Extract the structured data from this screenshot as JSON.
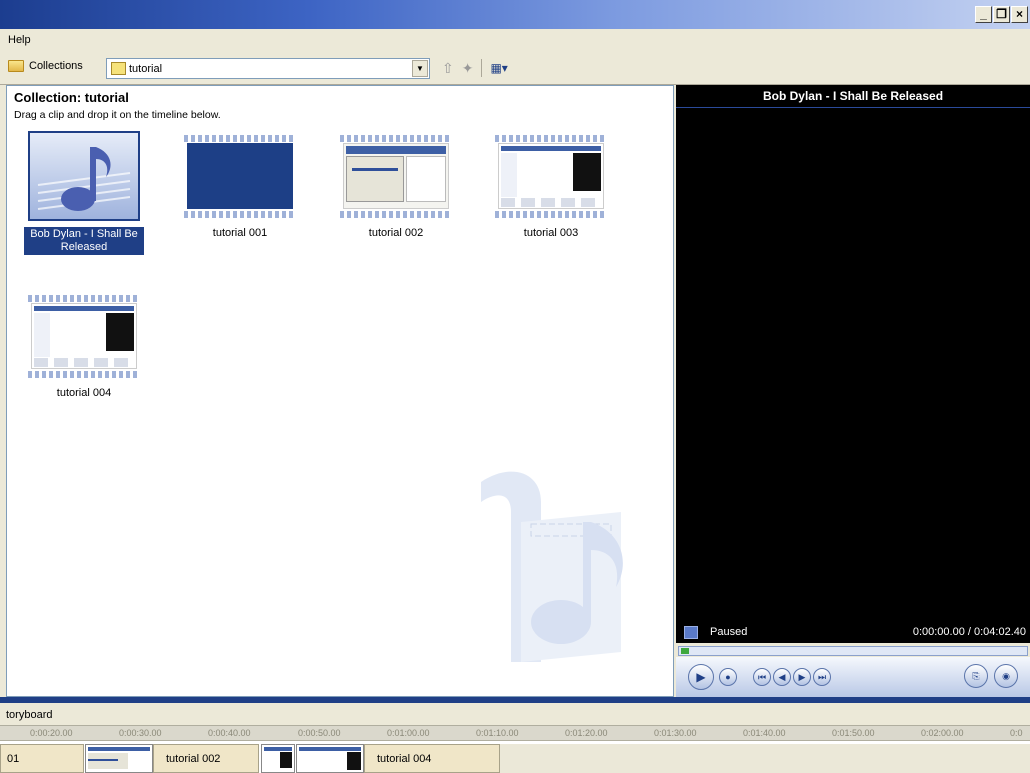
{
  "window": {
    "min": "_",
    "restore": "❐",
    "close": "×"
  },
  "menu": {
    "help": "Help"
  },
  "toolbar": {
    "collections_label": "Collections",
    "collection_value": "tutorial"
  },
  "collection": {
    "title": "Collection: tutorial",
    "instruction": "Drag a clip and drop it on the timeline below.",
    "clips": [
      {
        "label": "Bob Dylan - I Shall Be Released",
        "selected": true
      },
      {
        "label": "tutorial 001"
      },
      {
        "label": "tutorial 002"
      },
      {
        "label": "tutorial 003"
      },
      {
        "label": "tutorial 004"
      }
    ]
  },
  "player": {
    "title": "Bob Dylan - I Shall Be Released",
    "status": "Paused",
    "time": "0:00:00.00 / 0:04:02.40",
    "seek_fraction": 0
  },
  "storyboard": {
    "label": "toryboard",
    "ruler": [
      "0:00:20.00",
      "0:00:30.00",
      "0:00:40.00",
      "0:00:50.00",
      "0:01:00.00",
      "0:01:10.00",
      "0:01:20.00",
      "0:01:30.00",
      "0:01:40.00",
      "0:01:50.00",
      "0:02:00.00",
      "0:0"
    ],
    "segments": [
      "01",
      "tutorial 002",
      "tutorial 004"
    ]
  },
  "colors": {
    "accent": "#1f3f86",
    "player_bg": "#000000",
    "toolbar_bg": "#ece9d8"
  }
}
